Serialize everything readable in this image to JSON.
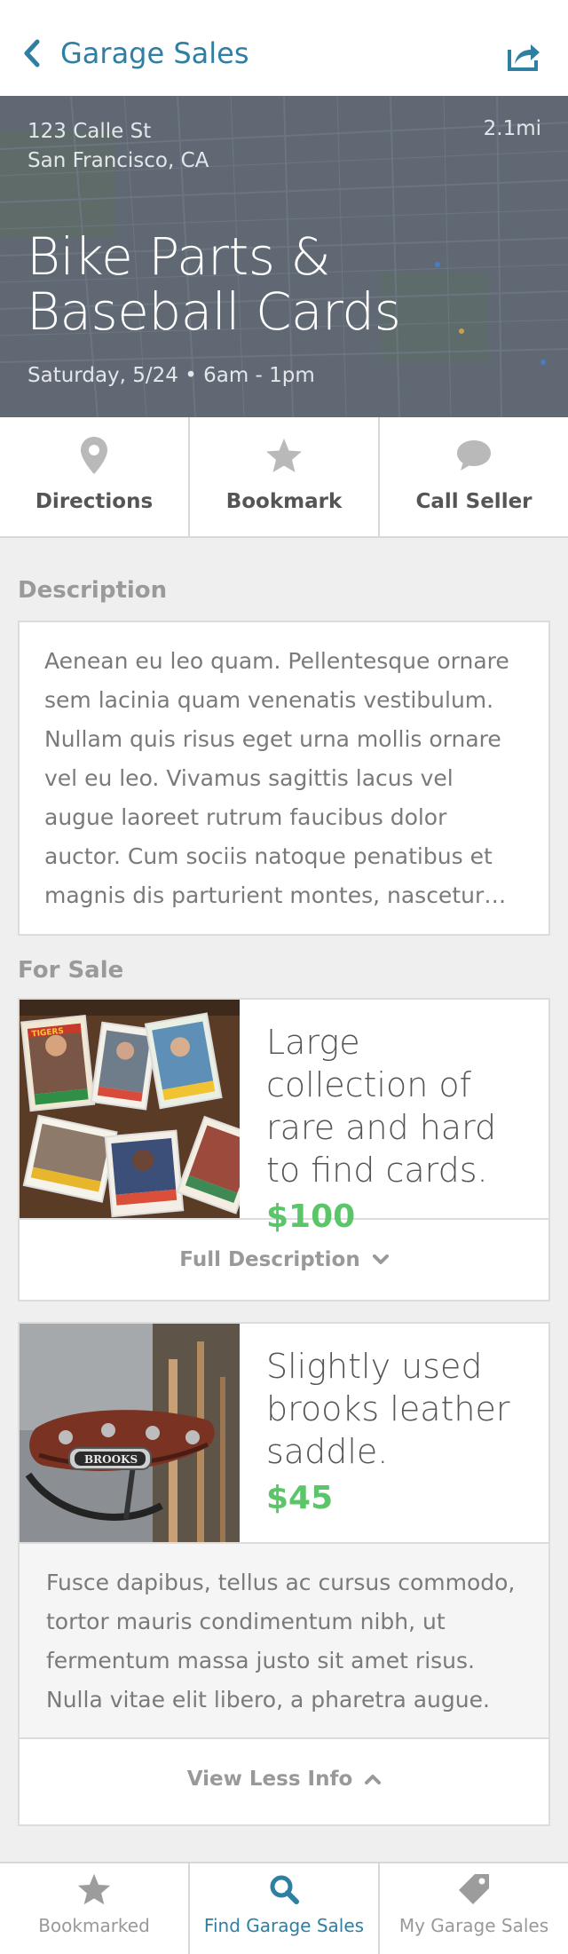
{
  "nav": {
    "back_label": "Garage Sales",
    "back_icon": "chevron-left-icon",
    "share_icon": "share-icon"
  },
  "hero": {
    "address_line1": "123 Calle St",
    "address_line2": "San Francisco, CA",
    "distance": "2.1mi",
    "title": "Bike Parts & Baseball Cards",
    "date": "Saturday, 5/24 • 6am - 1pm"
  },
  "actions": [
    {
      "label": "Directions",
      "icon": "map-pin-icon"
    },
    {
      "label": "Bookmark",
      "icon": "star-icon"
    },
    {
      "label": "Call Seller",
      "icon": "speech-bubble-icon"
    }
  ],
  "description": {
    "heading": "Description",
    "text": "Aenean eu leo quam. Pellentesque ornare sem lacinia quam venenatis vestibulum. Nullam quis risus eget urna mollis ornare vel eu leo. Vivamus sagittis lacus vel augue laoreet rutrum faucibus dolor auctor. Cum sociis natoque penatibus et magnis dis parturient montes, nascetur…"
  },
  "for_sale": {
    "heading": "For Sale",
    "items": [
      {
        "name": "Large collection of rare and hard to find cards.",
        "price": "$100",
        "toggle_label": "Full Description",
        "toggle_icon": "chevron-down-icon"
      },
      {
        "name": "Slightly used brooks leather saddle.",
        "price": "$45",
        "details": "Fusce dapibus, tellus ac cursus commodo, tortor mauris condimentum nibh, ut fermentum massa justo sit amet risus. Nulla vitae elit libero, a pharetra augue.",
        "toggle_label": "View Less Info",
        "toggle_icon": "chevron-up-icon",
        "brand_stamp": "BROOKS"
      }
    ]
  },
  "tabs": [
    {
      "label": "Bookmarked",
      "icon": "star-icon",
      "active": false
    },
    {
      "label": "Find Garage Sales",
      "icon": "search-icon",
      "active": true
    },
    {
      "label": "My Garage Sales",
      "icon": "tag-icon",
      "active": false
    }
  ],
  "colors": {
    "accent": "#2f7fa3",
    "price": "#5bc669",
    "hero_overlay": "#5d6670"
  }
}
